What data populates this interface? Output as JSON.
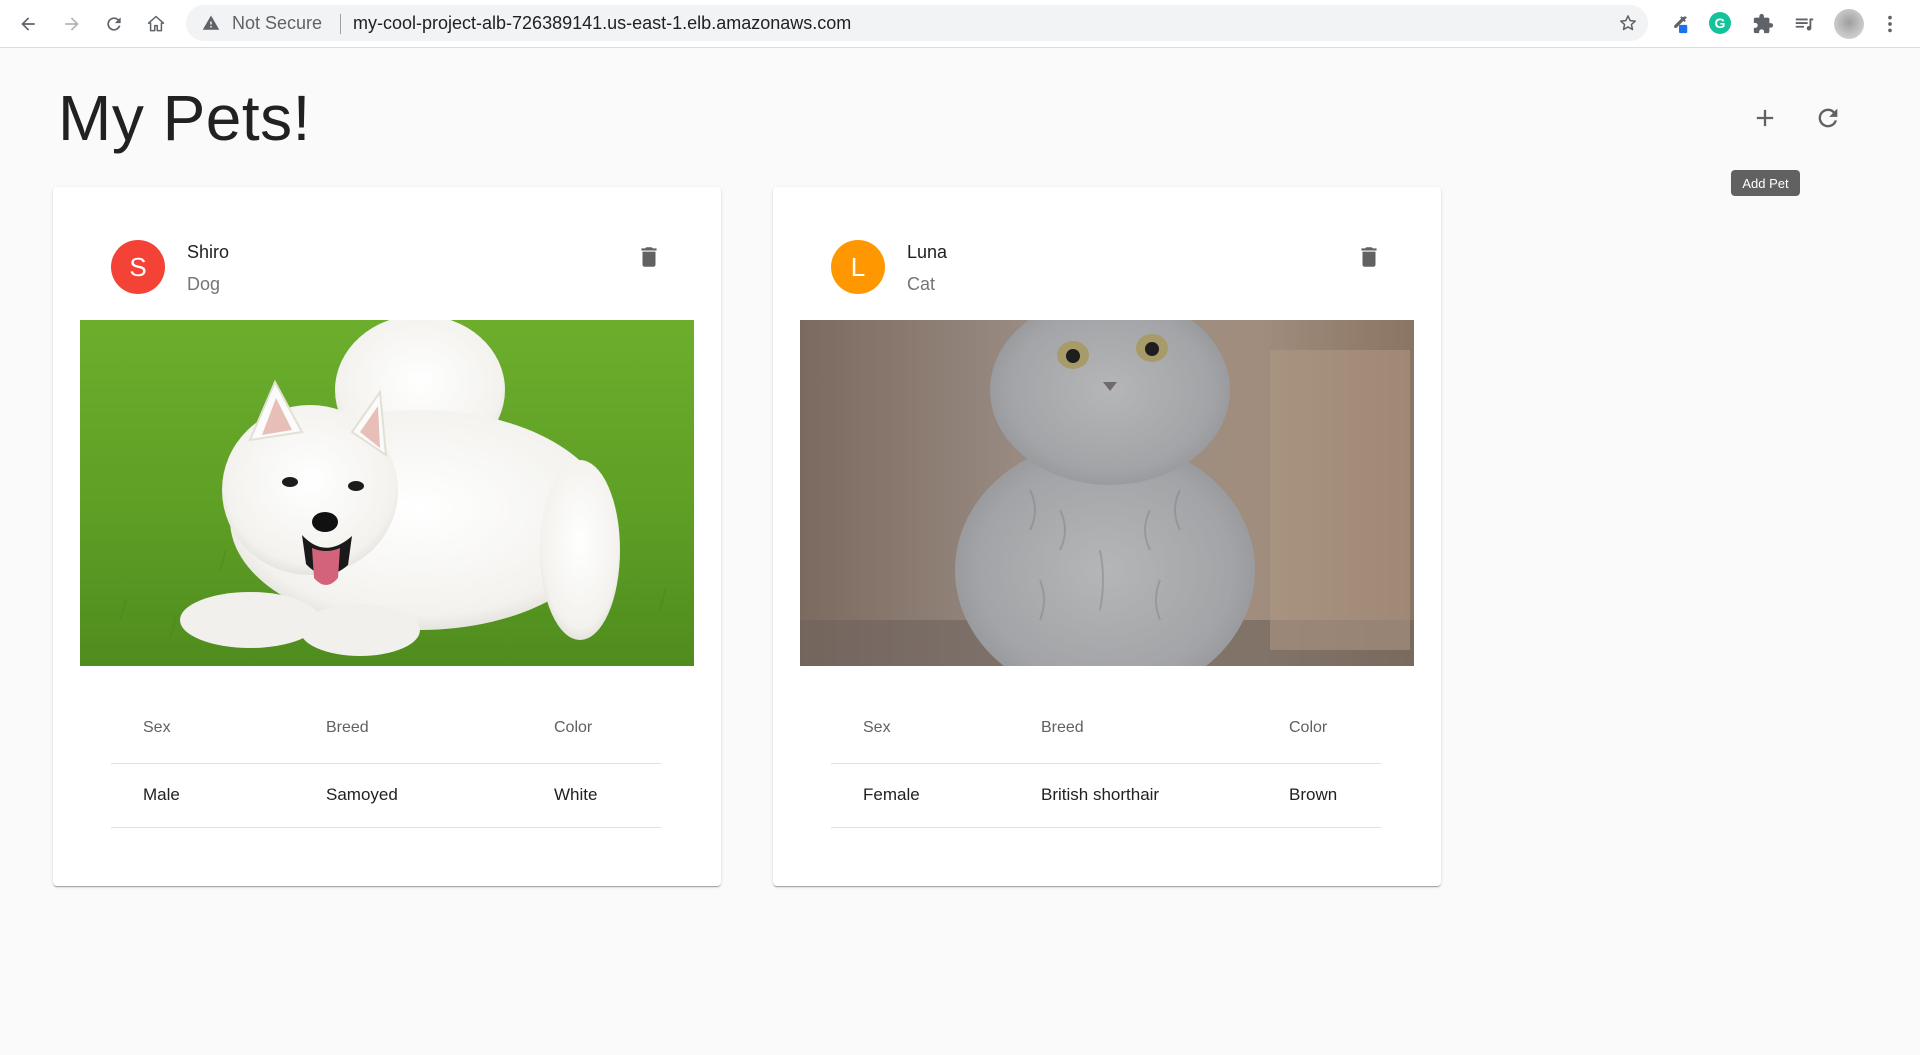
{
  "browser": {
    "security_label": "Not Secure",
    "url": "my-cool-project-alb-726389141.us-east-1.elb.amazonaws.com",
    "grammarly_letter": "G",
    "icons": [
      "back-arrow-icon",
      "forward-arrow-icon",
      "reload-icon",
      "home-icon",
      "warning-icon",
      "star-icon",
      "eyedropper-extension-icon",
      "grammarly-icon",
      "puzzle-extensions-icon",
      "media-queue-icon",
      "profile-avatar",
      "kebab-menu-icon"
    ]
  },
  "page": {
    "title": "My Pets!",
    "actions": {
      "add_icon": "plus-icon",
      "refresh_icon": "refresh-icon",
      "tooltip": "Add Pet"
    }
  },
  "table_headers": [
    "Sex",
    "Breed",
    "Color"
  ],
  "pets": [
    {
      "initial": "S",
      "name": "Shiro",
      "type": "Dog",
      "avatar_color": "#f44336",
      "sex": "Male",
      "breed": "Samoyed",
      "color": "White",
      "photo": "white fluffy dog playing on green grass"
    },
    {
      "initial": "L",
      "name": "Luna",
      "type": "Cat",
      "avatar_color": "#ff9800",
      "sex": "Female",
      "breed": "British shorthair",
      "color": "Brown",
      "photo": "grey kitten sitting indoors"
    }
  ],
  "colors": {
    "page_background": "#fafafa",
    "tooltip_background": "#616161",
    "icon_grey": "#616161"
  }
}
